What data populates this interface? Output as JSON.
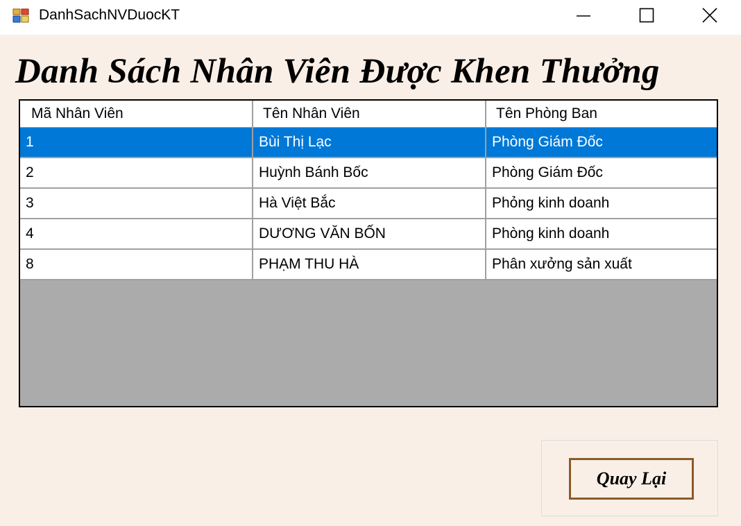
{
  "window": {
    "title": "DanhSachNVDuocKT",
    "icons": [
      "app-form-icon",
      "minimize-icon",
      "maximize-icon",
      "close-icon"
    ]
  },
  "heading": "Danh Sách Nhân Viên Được Khen Thưởng",
  "grid": {
    "columns": [
      "Mã Nhân Viên",
      "Tên Nhân Viên",
      "Tên Phòng Ban"
    ],
    "rows": [
      [
        "1",
        "Bùi Thị Lạc",
        "Phòng Giám Đốc"
      ],
      [
        "2",
        "Huỳnh Bánh Bốc",
        "Phòng Giám Đốc"
      ],
      [
        "3",
        "Hà Việt Bắc",
        "Phỏng kinh doanh"
      ],
      [
        "4",
        "DƯƠNG VĂN BỐN",
        "Phòng kinh doanh"
      ],
      [
        "8",
        "PHẠM THU HÀ",
        "Phân xưởng sản xuất"
      ]
    ],
    "selected_row": 1
  },
  "buttons": {
    "back_label": "Quay Lại"
  },
  "colors": {
    "selection": "#0078d7",
    "form_background": "#faefe6",
    "grid_empty_area": "#ababab",
    "button_border": "#8b5a2b"
  }
}
